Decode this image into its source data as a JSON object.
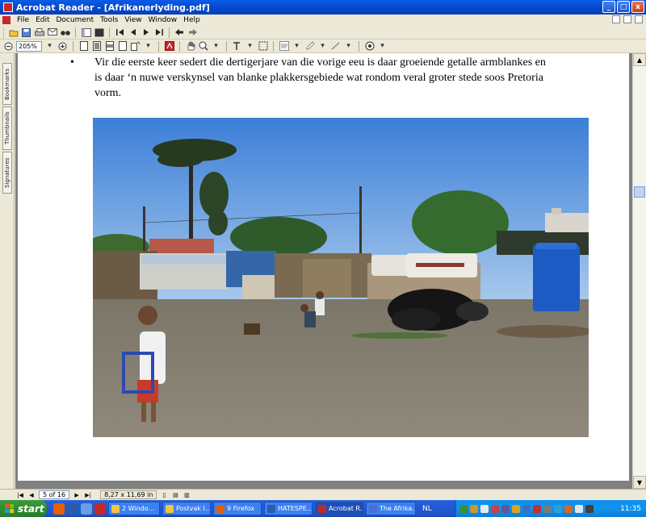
{
  "window": {
    "title": "Acrobat Reader - [Afrikanerlyding.pdf]",
    "controls": [
      "_",
      "□",
      "x"
    ]
  },
  "menubar": {
    "items": [
      "File",
      "Edit",
      "Document",
      "Tools",
      "View",
      "Window",
      "Help"
    ]
  },
  "toolbar": {
    "zoom_value": "205%"
  },
  "nav_tabs": [
    "Bookmarks",
    "Thumbnails",
    "Signatures"
  ],
  "document": {
    "bullet": "•",
    "paragraph": "Vir die eerste keer sedert die dertigerjare van die vorige eeu is daar groeiende getalle armblankes en is daar ‘n nuwe verskynsel van blanke plakkersgebiede wat rondom veral groter stede soos Pretoria vorm."
  },
  "statusbar": {
    "page": "5 of 16",
    "page_size": "8,27 x 11,69 in"
  },
  "taskbar": {
    "start_label": "start",
    "tasks": [
      {
        "label": "2 Windo...",
        "color": "#f3c63d"
      },
      {
        "label": "Postvak I...",
        "color": "#f3c63d"
      },
      {
        "label": "9 Firefox",
        "color": "#e66000"
      },
      {
        "label": "HATESPE...",
        "color": "#2a5caa"
      },
      {
        "label": "Acrobat R...",
        "color": "#c62828"
      },
      {
        "label": "The Afrika...",
        "color": "#4a6fd0"
      }
    ],
    "language": "NL",
    "clock": "11:35"
  }
}
